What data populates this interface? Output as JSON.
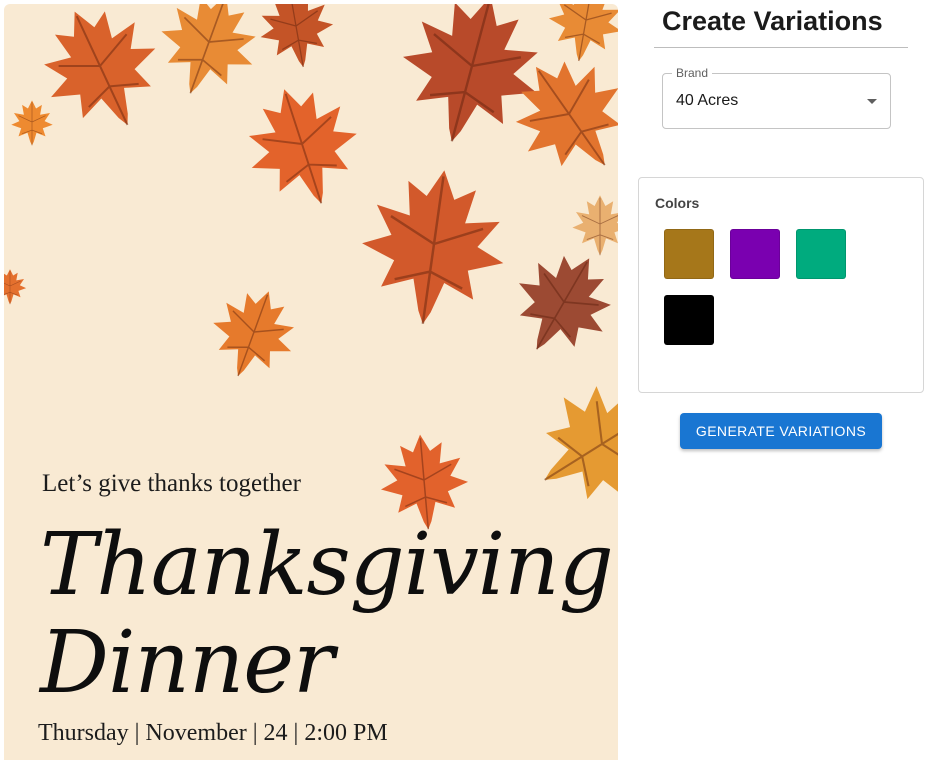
{
  "preview": {
    "tagline": "Let’s give thanks together",
    "title_line1": "Thanksgiving",
    "title_line2": "Dinner",
    "date_line": "Thursday | November | 24 | 2:00 PM",
    "background_color": "#f9ead3",
    "decoration": "maple-leaf-icon"
  },
  "panel": {
    "title": "Create Variations",
    "brand": {
      "label": "Brand",
      "value": "40 Acres",
      "icon": "chevron-down-icon"
    },
    "colors": {
      "label": "Colors",
      "swatches": [
        {
          "name": "brown",
          "hex": "#a6771a"
        },
        {
          "name": "purple",
          "hex": "#7a00b0"
        },
        {
          "name": "green",
          "hex": "#00ab7e"
        },
        {
          "name": "black",
          "hex": "#000000"
        }
      ]
    },
    "generate_button": "GENERATE VARIATIONS"
  },
  "theme": {
    "accent": "#1976d2"
  }
}
